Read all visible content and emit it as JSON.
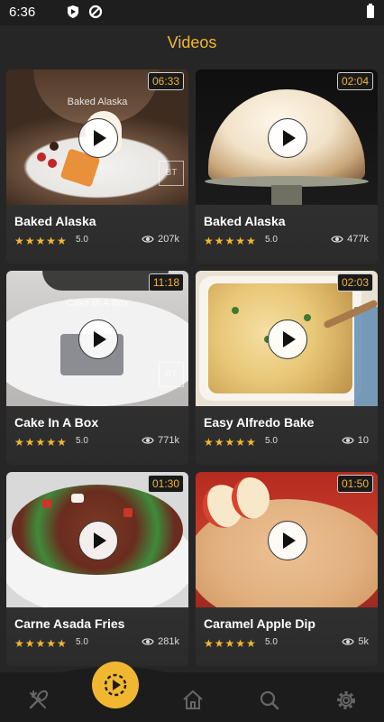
{
  "status": {
    "time": "6:36",
    "icons": [
      "shield-icon",
      "data-saver-icon"
    ],
    "battery": "battery-icon"
  },
  "header": {
    "title": "Videos"
  },
  "colors": {
    "accent": "#f2b731",
    "background": "#262626",
    "card": "#333333"
  },
  "videos": [
    {
      "title": "Baked Alaska",
      "duration": "06:33",
      "rating": "5.0",
      "views": "207k",
      "overlay": "Baked Alaska",
      "watermark": "BT"
    },
    {
      "title": "Baked Alaska",
      "duration": "02:04",
      "rating": "5.0",
      "views": "477k"
    },
    {
      "title": "Cake In A Box",
      "duration": "11:18",
      "rating": "5.0",
      "views": "771k",
      "overlay": "Cake In A Box",
      "watermark": "BT"
    },
    {
      "title": "Easy Alfredo Bake",
      "duration": "02:03",
      "rating": "5.0",
      "views": "10"
    },
    {
      "title": "Carne Asada Fries",
      "duration": "01:30",
      "rating": "5.0",
      "views": "281k"
    },
    {
      "title": "Caramel Apple Dip",
      "duration": "01:50",
      "rating": "5.0",
      "views": "5k"
    }
  ],
  "nav": {
    "items": [
      "recipes-icon",
      "videos-icon",
      "home-icon",
      "search-icon",
      "settings-icon"
    ],
    "active": "videos-icon"
  }
}
